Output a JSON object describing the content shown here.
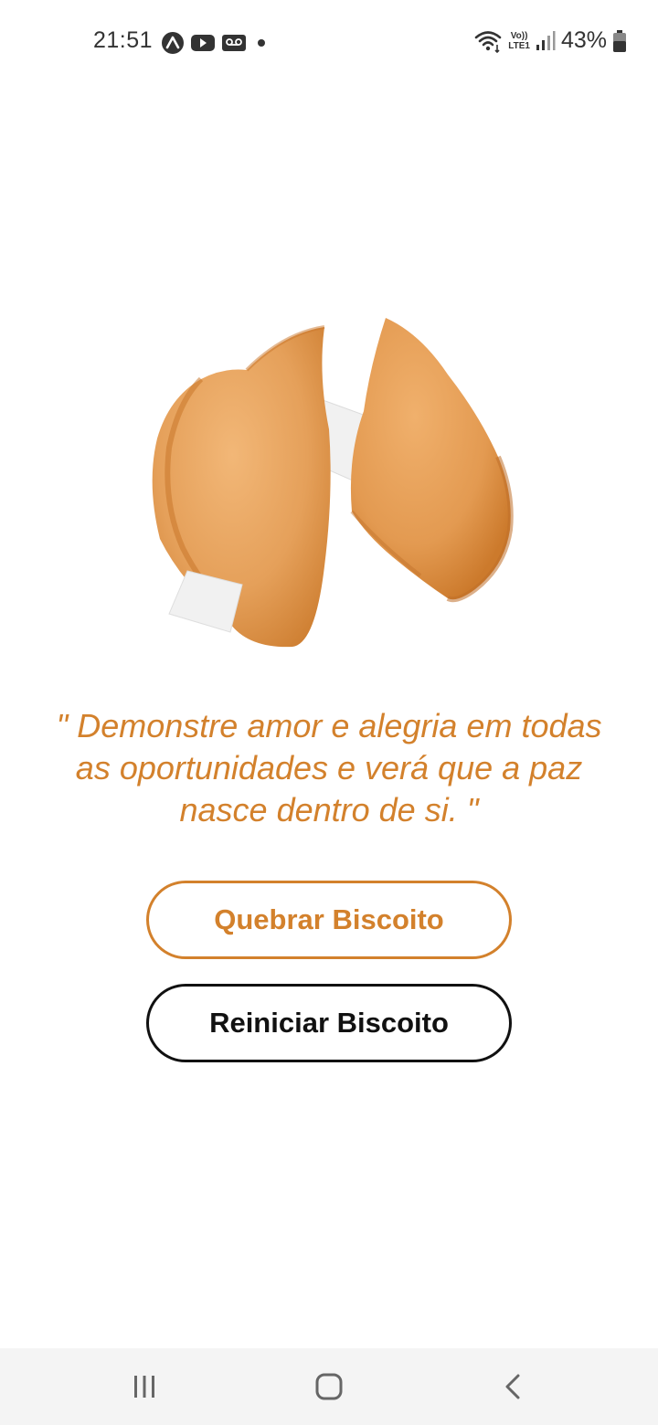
{
  "status_bar": {
    "time": "21:51",
    "battery_percent": "43%",
    "volte_top": "Vo))",
    "volte_bottom": "LTE1",
    "icons": [
      "expo-go-icon",
      "youtube-icon",
      "voicemail-icon",
      "dot-icon",
      "wifi-icon",
      "signal-icon",
      "battery-icon"
    ]
  },
  "fortune": {
    "image": "fortune-cookie-broken",
    "quote": "\" Demonstre amor e alegria em todas as oportunidades e verá que a paz nasce dentro de si. \""
  },
  "buttons": {
    "break_label": "Quebrar Biscoito",
    "reset_label": "Reiniciar Biscoito"
  },
  "nav_bar": {
    "icons": [
      "recent-apps-icon",
      "home-icon",
      "back-icon"
    ]
  },
  "colors": {
    "accent": "#d3812c",
    "text_dark": "#111111",
    "nav_background": "#f4f4f4"
  }
}
